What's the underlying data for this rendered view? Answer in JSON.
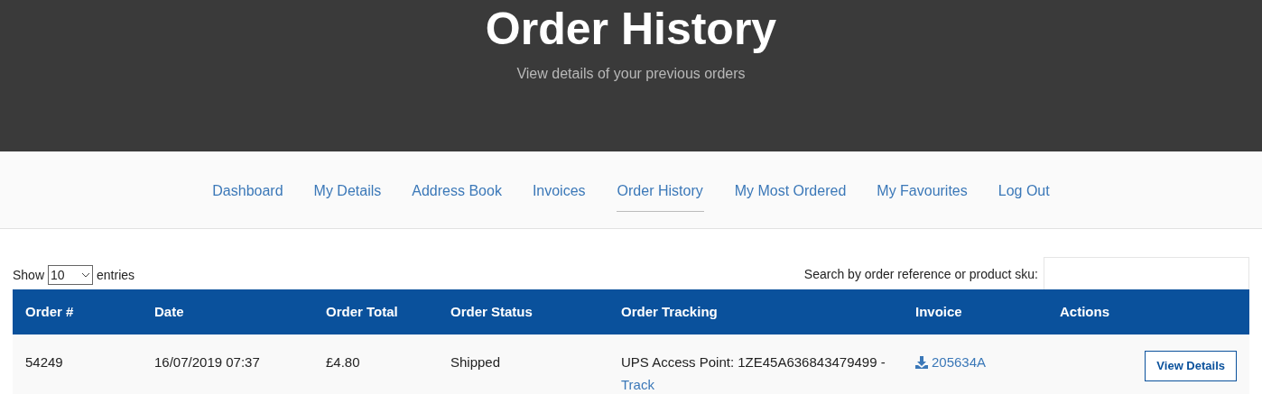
{
  "hero": {
    "title": "Order History",
    "subtitle": "View details of your previous orders"
  },
  "nav": [
    {
      "label": "Dashboard",
      "selected": false
    },
    {
      "label": "My Details",
      "selected": false
    },
    {
      "label": "Address Book",
      "selected": false
    },
    {
      "label": "Invoices",
      "selected": false
    },
    {
      "label": "Order History",
      "selected": true
    },
    {
      "label": "My Most Ordered",
      "selected": false
    },
    {
      "label": "My Favourites",
      "selected": false
    },
    {
      "label": "Log Out",
      "selected": false
    }
  ],
  "length": {
    "before": "Show",
    "value": "10",
    "after": "entries"
  },
  "search": {
    "label": "Search by order reference or product sku:"
  },
  "table": {
    "columns": [
      "Order #",
      "Date",
      "Order Total",
      "Order Status",
      "Order Tracking",
      "Invoice",
      "Actions"
    ],
    "rows": [
      {
        "order": "54249",
        "date": "16/07/2019 07:37",
        "total": "£4.80",
        "status": "Shipped",
        "tracking": "UPS Access Point: 1ZE45A636843479499 -",
        "track_link": "Track",
        "invoice": "205634A",
        "action": "View Details"
      }
    ]
  }
}
